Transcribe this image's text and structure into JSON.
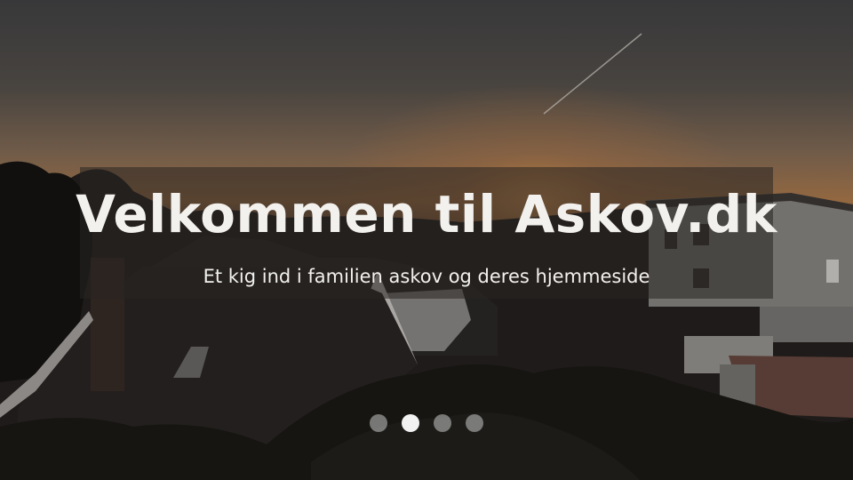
{
  "hero": {
    "title": "Velkommen til Askov.dk",
    "subtitle": "Et kig ind i familien askov og deres hjemmeside"
  },
  "carousel": {
    "slide_count": 4,
    "active_index": 1
  },
  "colors": {
    "text": "#f3f1ee",
    "indicator_active": "#f2f2f2",
    "indicator_inactive": "#a0a0a0",
    "sky_top": "#4a4a4c",
    "sky_horizon": "#c9884a"
  }
}
